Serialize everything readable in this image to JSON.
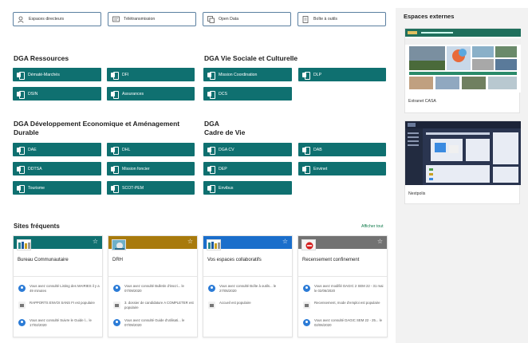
{
  "quick_links": [
    {
      "label": "Espaces directeurs",
      "icon": "person-icon"
    },
    {
      "label": "Télétransmission",
      "icon": "transmit-icon"
    },
    {
      "label": "Open Data",
      "icon": "data-icon"
    },
    {
      "label": "Boîte à outils",
      "icon": "toolbox-icon"
    }
  ],
  "sections": {
    "ressources": {
      "title": "DGA Ressources",
      "tiles": [
        "Dématé-Marchés",
        "DFI",
        "DSIN",
        "Assurances"
      ]
    },
    "vie_sociale": {
      "title": "DGA Vie Sociale et Culturelle",
      "tiles": [
        "Mission Coordination",
        "DLP",
        "DCS"
      ]
    },
    "developpement": {
      "title_line1": "DGA Développement Economique et Aménagement",
      "title_line2": "Durable",
      "tiles": [
        "DAE",
        "DHL",
        "DDTSA",
        "Mission foncier",
        "Tourisme",
        "SCOT-PEM"
      ]
    },
    "cadre_de_vie": {
      "title_line1": "DGA",
      "title_line2": "Cadre de Vie",
      "tiles": [
        "DGA CV",
        "DAB",
        "DEP",
        "Envinet",
        "Envibus"
      ]
    }
  },
  "frequent": {
    "title": "Sites fréquents",
    "show_all": "Afficher tout",
    "cards": [
      {
        "name": "Bureau Communautaire",
        "band_color": "#0f7070",
        "activities": [
          {
            "icon": "user",
            "text": "Vous avez consulté Listing des MAIRIES il y a 49 minutes"
          },
          {
            "icon": "doc",
            "text": "RAPPORTS ENVOI SANS FI est populaire"
          },
          {
            "icon": "user",
            "text": "Vous avez consulté Suivre le Guide l... le 17/02/2020"
          }
        ]
      },
      {
        "name": "DRH",
        "band_color": "#a87a0c",
        "activities": [
          {
            "icon": "user",
            "text": "Vous avez consulté Bulletin d'inscri... le 07/09/2020"
          },
          {
            "icon": "doc",
            "text": "3. dossier de candidature A COMPLETER est populaire"
          },
          {
            "icon": "user",
            "text": "Vous avez consulté Guide d'utilisati... le 07/09/2020"
          }
        ]
      },
      {
        "name": "Vos espaces collaboratifs",
        "band_color": "#1a6ecb",
        "activities": [
          {
            "icon": "user",
            "text": "Vous avez consulté Boîte à outils... le 27/05/2020"
          },
          {
            "icon": "doc",
            "text": "Accueil est populaire"
          }
        ]
      },
      {
        "name": "Recensement confinement",
        "band_color": "#727272",
        "activities": [
          {
            "icon": "user",
            "text": "Vous avez modifié DAGIC 2 SEM 22 - 31 mai le 02/06/2020"
          },
          {
            "icon": "doc",
            "text": "Recensement, mode d'emploi est populaire"
          },
          {
            "icon": "user",
            "text": "Vous avez consulté DAGIC SEM 22 - 25... le 02/06/2020"
          }
        ]
      }
    ]
  },
  "external": {
    "title": "Espaces externes",
    "items": [
      {
        "label": "Extranet CASA"
      },
      {
        "label": "Nextpolis"
      }
    ]
  },
  "colors": {
    "tile": "#0f7070",
    "panel": "#f2f2f2",
    "link_green": "#0f7a4a"
  }
}
